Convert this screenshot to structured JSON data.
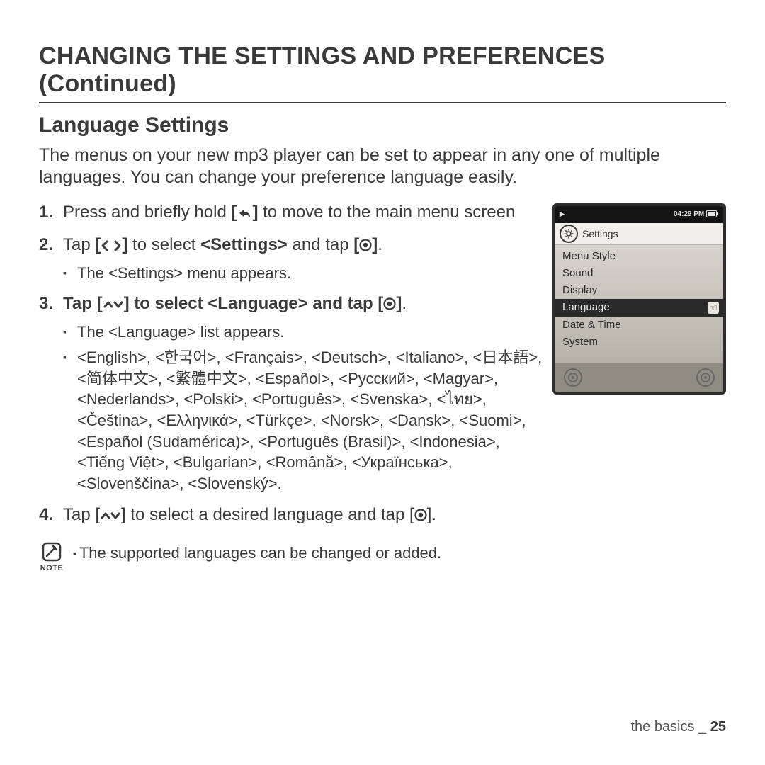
{
  "heading_main": "CHANGING THE SETTINGS AND PREFERENCES (Continued)",
  "heading_sub": "Language Settings",
  "intro": "The menus on your new mp3 player can be set to appear in any one of multiple languages. You can change your preference language easily.",
  "steps": {
    "s1_a": "Press and briefly hold ",
    "s1_b": " to move to the main menu screen",
    "s2_a": "Tap ",
    "s2_b": " to select ",
    "s2_target": "<Settings>",
    "s2_c": " and tap ",
    "s2_sub1": "The <Settings> menu appears.",
    "s3_a": "Tap ",
    "s3_b": " to select ",
    "s3_target": "<Language>",
    "s3_c": " and tap ",
    "s3_sub1": "The <Language> list appears.",
    "s3_sub2": "<English>, <한국어>, <Français>, <Deutsch>, <Italiano>, <日本語>, <简体中文>, <繁體中文>, <Español>, <Русский>, <Magyar>, <Nederlands>, <Polski>, <Português>, <Svenska>, <ไทย>, <Čeština>, <Ελληνικά>, <Türkçe>, <Norsk>, <Dansk>, <Suomi>, <Español (Sudamérica)>, <Português (Brasil)>, <Indonesia>, <Tiếng Việt>, <Bulgarian>, <Română>, <Українська>, <Slovenščina>, <Slovenský>.",
    "s4_a": "Tap ",
    "s4_b": " to select a desired language and tap "
  },
  "note_label": "NOTE",
  "note_text": "The supported languages can be changed or added.",
  "footer_section": "the basics _ ",
  "footer_page": "25",
  "device": {
    "time": "04:29 PM",
    "title": "Settings",
    "items": [
      "Menu Style",
      "Sound",
      "Display",
      "Language",
      "Date & Time",
      "System"
    ],
    "selected_index": 3
  }
}
